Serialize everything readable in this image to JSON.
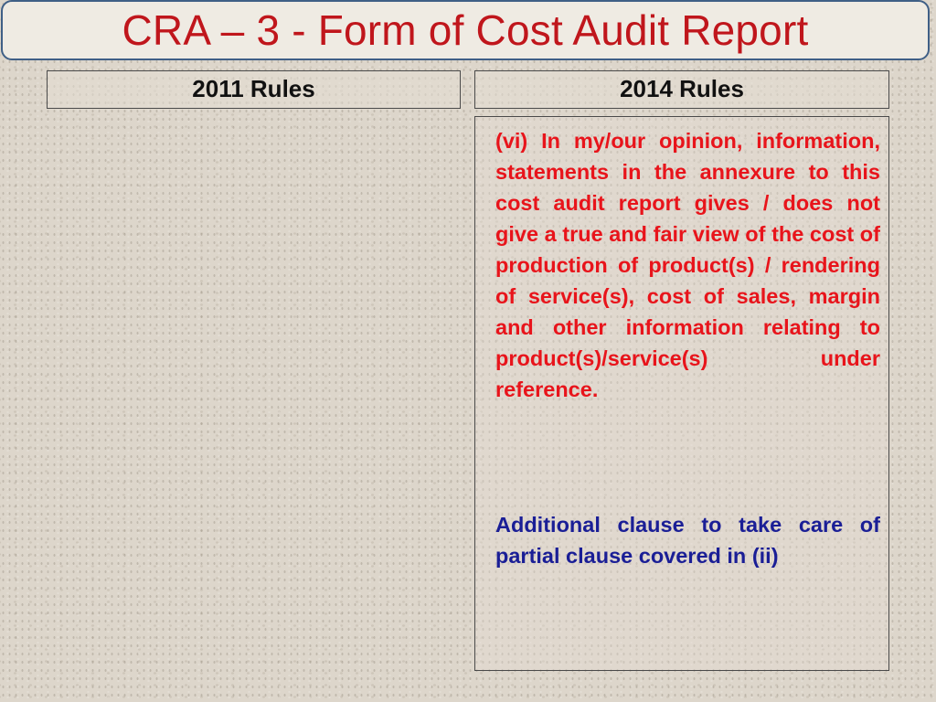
{
  "slide": {
    "title": "CRA – 3 - Form of Cost Audit Report"
  },
  "table": {
    "headers": [
      "2011 Rules",
      "2014 Rules"
    ],
    "right_column": {
      "clause_vi": "(vi) In my/our opinion, information, statements in the annexure to this cost audit report gives / does not give a true and fair view of the cost of production of product(s) / rendering of service(s), cost of sales, margin and other information relating to product(s)/service(s) under reference.",
      "note": "Additional clause to take care of partial clause covered in (ii)"
    }
  },
  "colors": {
    "title": "#c0161c",
    "clause_text": "#e8141b",
    "note_text": "#1a1e96",
    "title_border": "#3f5f86"
  }
}
